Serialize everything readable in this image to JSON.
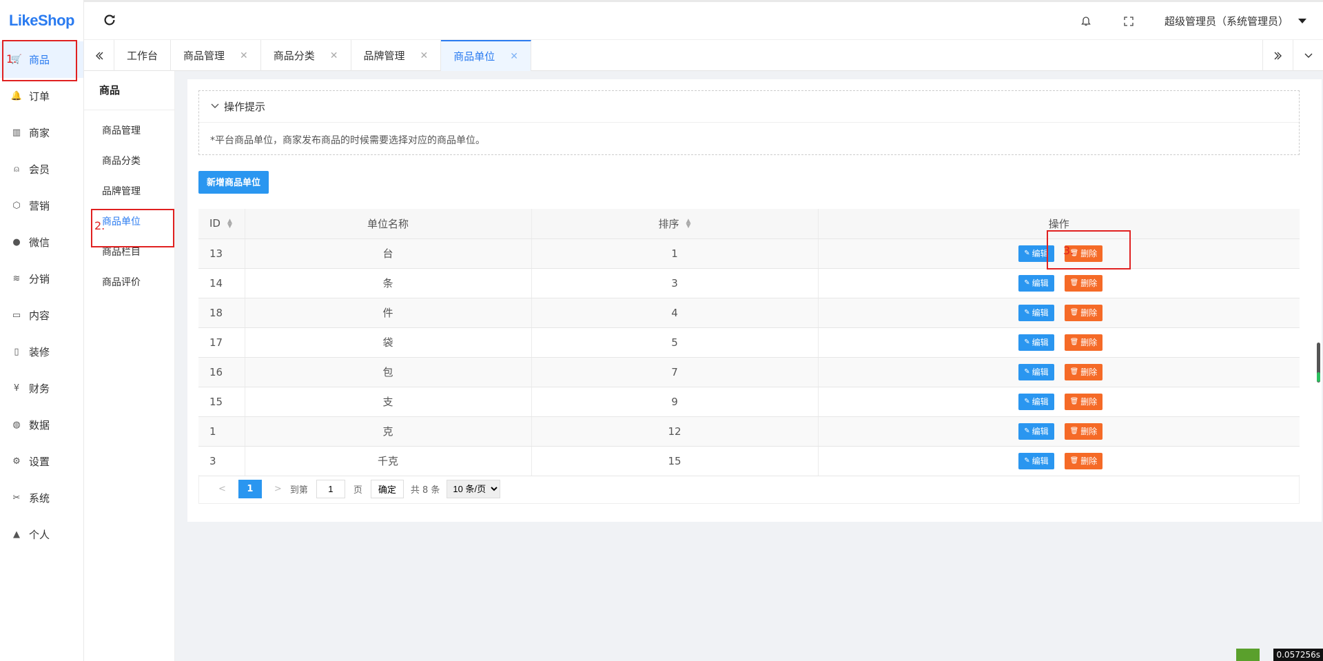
{
  "brand": {
    "logo": "LikeShop"
  },
  "sidebar": {
    "items": [
      {
        "label": "商品",
        "icon": "cart-icon",
        "active": true
      },
      {
        "label": "订单",
        "icon": "bell-icon"
      },
      {
        "label": "商家",
        "icon": "store-icon"
      },
      {
        "label": "会员",
        "icon": "user-icon"
      },
      {
        "label": "营销",
        "icon": "cube-icon"
      },
      {
        "label": "微信",
        "icon": "wechat-icon"
      },
      {
        "label": "分销",
        "icon": "layers-icon"
      },
      {
        "label": "内容",
        "icon": "book-icon"
      },
      {
        "label": "装修",
        "icon": "tablet-icon"
      },
      {
        "label": "财务",
        "icon": "yen-icon"
      },
      {
        "label": "数据",
        "icon": "globe-icon"
      },
      {
        "label": "设置",
        "icon": "gear-icon"
      },
      {
        "label": "系统",
        "icon": "tools-icon"
      },
      {
        "label": "个人",
        "icon": "person-icon"
      }
    ]
  },
  "header": {
    "user": "超级管理员（系统管理员）"
  },
  "tabs": [
    {
      "label": "工作台",
      "closable": false
    },
    {
      "label": "商品管理",
      "closable": true
    },
    {
      "label": "商品分类",
      "closable": true
    },
    {
      "label": "品牌管理",
      "closable": true
    },
    {
      "label": "商品单位",
      "closable": true,
      "active": true
    }
  ],
  "subnav": {
    "title": "商品",
    "items": [
      "商品管理",
      "商品分类",
      "品牌管理",
      "商品单位",
      "商品栏目",
      "商品评价"
    ]
  },
  "tips": {
    "title": "操作提示",
    "text": "*平台商品单位，商家发布商品的时候需要选择对应的商品单位。"
  },
  "actions": {
    "add": "新增商品单位"
  },
  "table": {
    "headers": [
      "ID",
      "单位名称",
      "排序",
      "操作"
    ],
    "edit_label": "编辑",
    "delete_label": "删除",
    "rows": [
      {
        "id": "13",
        "name": "台",
        "sort": "1"
      },
      {
        "id": "14",
        "name": "条",
        "sort": "3"
      },
      {
        "id": "18",
        "name": "件",
        "sort": "4"
      },
      {
        "id": "17",
        "name": "袋",
        "sort": "5"
      },
      {
        "id": "16",
        "name": "包",
        "sort": "7"
      },
      {
        "id": "15",
        "name": "支",
        "sort": "9"
      },
      {
        "id": "1",
        "name": "克",
        "sort": "12"
      },
      {
        "id": "3",
        "name": "千克",
        "sort": "15"
      }
    ]
  },
  "pager": {
    "current": "1",
    "goto_prefix": "到第",
    "goto_value": "1",
    "goto_suffix": "页",
    "confirm": "确定",
    "total": "共 8 条",
    "page_size": "10 条/页"
  },
  "annotations": [
    "1.",
    "2.",
    "3."
  ],
  "overlay": {
    "corner_text": "0.057256s"
  }
}
